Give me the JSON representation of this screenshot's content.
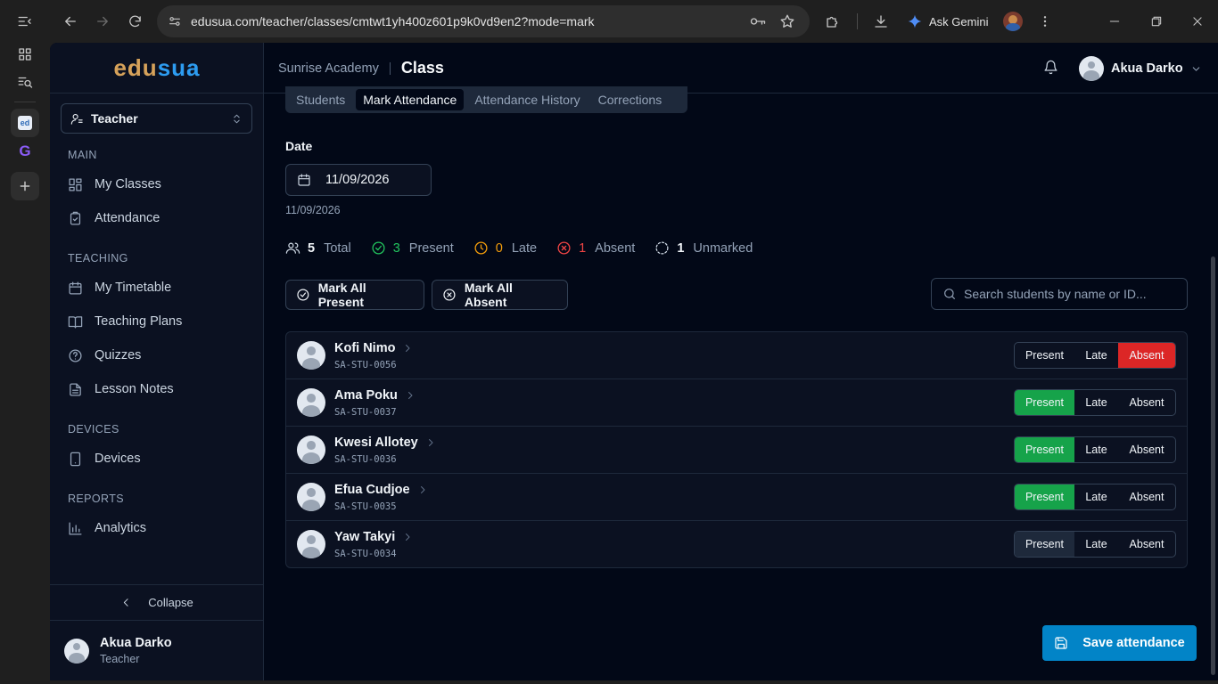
{
  "browser": {
    "url": "edusua.com/teacher/classes/cmtwt1yh400z601p9k0vd9en2?mode=mark",
    "gemini_label": "Ask Gemini"
  },
  "brand": {
    "part1": "edu",
    "part2": "sua",
    "color1": "#d6a25a",
    "color2": "#2d9cf0"
  },
  "sidebar": {
    "role": "Teacher",
    "sections": [
      {
        "title": "MAIN",
        "items": [
          {
            "label": "My Classes",
            "icon": "grid-icon"
          },
          {
            "label": "Attendance",
            "icon": "clipboard-check-icon"
          }
        ]
      },
      {
        "title": "TEACHING",
        "items": [
          {
            "label": "My Timetable",
            "icon": "calendar-icon"
          },
          {
            "label": "Teaching Plans",
            "icon": "book-open-icon"
          },
          {
            "label": "Quizzes",
            "icon": "help-circle-icon"
          },
          {
            "label": "Lesson Notes",
            "icon": "file-text-icon"
          }
        ]
      },
      {
        "title": "DEVICES",
        "items": [
          {
            "label": "Devices",
            "icon": "tablet-icon"
          }
        ]
      },
      {
        "title": "REPORTS",
        "items": [
          {
            "label": "Analytics",
            "icon": "bar-chart-icon"
          }
        ]
      }
    ],
    "collapse_label": "Collapse",
    "user": {
      "name": "Akua Darko",
      "role": "Teacher"
    }
  },
  "header": {
    "school": "Sunrise Academy",
    "page": "Class",
    "user_name": "Akua Darko"
  },
  "tabs": [
    {
      "label": "Students",
      "active": false
    },
    {
      "label": "Mark Attendance",
      "active": true
    },
    {
      "label": "Attendance History",
      "active": false
    },
    {
      "label": "Corrections",
      "active": false
    }
  ],
  "date": {
    "label": "Date",
    "value": "11/09/2026",
    "caption": "11/09/2026"
  },
  "stats": {
    "total": {
      "count": "5",
      "label": "Total",
      "color": "#cbd5e1"
    },
    "present": {
      "count": "3",
      "label": "Present",
      "color": "#22c55e"
    },
    "late": {
      "count": "0",
      "label": "Late",
      "color": "#f59e0b"
    },
    "absent": {
      "count": "1",
      "label": "Absent",
      "color": "#ef4444"
    },
    "unmarked": {
      "count": "1",
      "label": "Unmarked",
      "color": "#cbd5e1"
    }
  },
  "actions": {
    "mark_all_present": "Mark All Present",
    "mark_all_absent": "Mark All Absent"
  },
  "search": {
    "placeholder": "Search students by name or ID..."
  },
  "status_labels": {
    "present": "Present",
    "late": "Late",
    "absent": "Absent"
  },
  "students": [
    {
      "name": "Kofi Nimo",
      "id": "SA-STU-0056",
      "status": "absent"
    },
    {
      "name": "Ama Poku",
      "id": "SA-STU-0037",
      "status": "present"
    },
    {
      "name": "Kwesi Allotey",
      "id": "SA-STU-0036",
      "status": "present"
    },
    {
      "name": "Efua Cudjoe",
      "id": "SA-STU-0035",
      "status": "present"
    },
    {
      "name": "Yaw Takyi",
      "id": "SA-STU-0034",
      "status": "unmarked"
    }
  ],
  "save_label": "Save attendance"
}
